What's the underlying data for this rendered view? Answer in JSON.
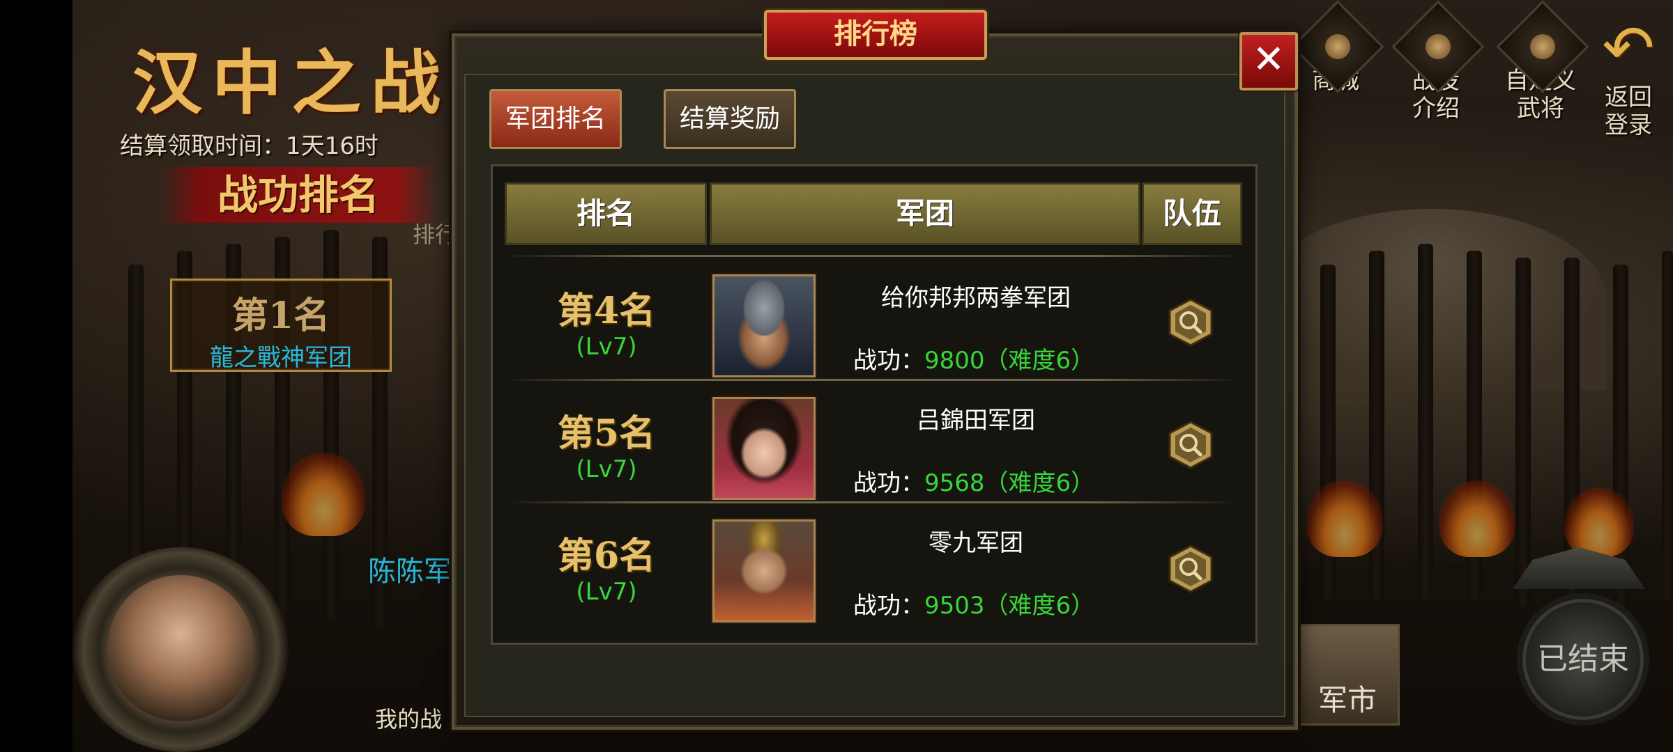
{
  "left_panel": {
    "event_title": "汉中之战",
    "settle_time": "结算领取时间：1天16时",
    "merit_ranking": "战功排名",
    "partial_tab": "排行",
    "top_rank": "第1名",
    "top_guild": "龍之戰神军团",
    "my_guild_partial": "陈陈军",
    "my_merit_partial": "我的战"
  },
  "top_menu": [
    {
      "label": "商城",
      "icon": "shop-icon"
    },
    {
      "label": "战役介绍",
      "icon": "campaign-icon"
    },
    {
      "label": "自定义武将",
      "icon": "custom-general-icon"
    },
    {
      "label": "返回登录",
      "icon": "back-arrow-icon"
    }
  ],
  "bottom_right": {
    "market_partial": "军市",
    "ended_button": "已结束"
  },
  "dialog": {
    "title": "排行榜",
    "close": "✕",
    "tabs": {
      "guild_rank": "军团排名",
      "settle_reward": "结算奖励"
    },
    "headers": {
      "rank": "排名",
      "guild": "军团",
      "team": "队伍"
    },
    "rows": [
      {
        "rank": "第4名",
        "level": "(Lv7)",
        "guild": "给你邦邦两拳军团",
        "merit_label": "战功：",
        "merit_value": "9800（难度6）"
      },
      {
        "rank": "第5名",
        "level": "(Lv7)",
        "guild": "吕錦田军团",
        "merit_label": "战功：",
        "merit_value": "9568（难度6）"
      },
      {
        "rank": "第6名",
        "level": "(Lv7)",
        "guild": "零九军团",
        "merit_label": "战功：",
        "merit_value": "9503（难度6）"
      }
    ]
  },
  "colors": {
    "accent_gold": "#e6c06d",
    "merit_green": "#37d63a",
    "banner_red": "#c41c1c"
  }
}
